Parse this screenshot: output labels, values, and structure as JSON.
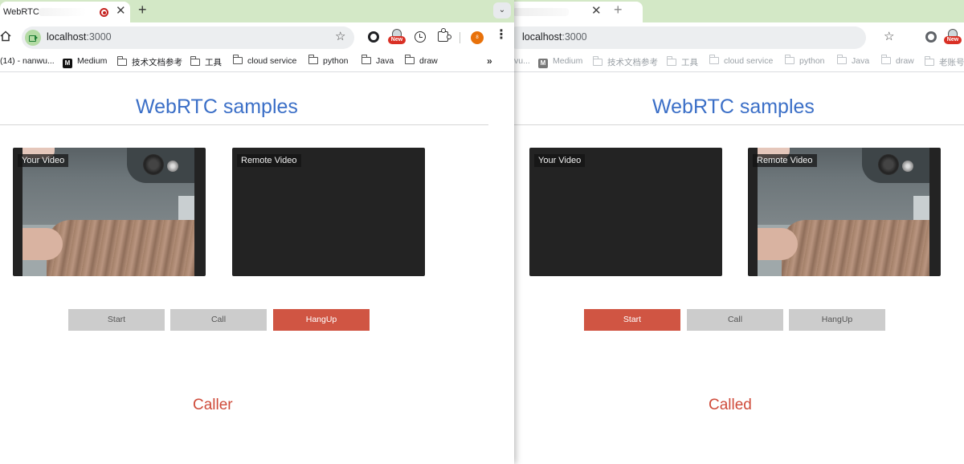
{
  "colors": {
    "heading": "#3b6fc7",
    "active_button": "#d05543",
    "role_text": "#cf4b3a",
    "tab_strip": "#d3e8c6"
  },
  "caller": {
    "tab": {
      "title": "WebRTC ⁻",
      "recording_icon": "record-icon"
    },
    "url": {
      "host": "localhost",
      "port": ":3000"
    },
    "new_badge": "New",
    "avatar_text": "8",
    "bookmarks": [
      {
        "label": "(14) - nanwu...",
        "icon": "none"
      },
      {
        "label": "Medium",
        "icon": "medium-icon"
      },
      {
        "label": "技术文档参考",
        "icon": "folder-icon"
      },
      {
        "label": "工具",
        "icon": "folder-icon"
      },
      {
        "label": "cloud service",
        "icon": "folder-icon"
      },
      {
        "label": "python",
        "icon": "folder-icon"
      },
      {
        "label": "Java",
        "icon": "folder-icon"
      },
      {
        "label": "draw",
        "icon": "folder-icon"
      }
    ],
    "bookmarks_more": "»",
    "page": {
      "title": "WebRTC samples",
      "local_video_label": "Your Video",
      "remote_video_label": "Remote Video",
      "local_video_has_stream": true,
      "remote_video_has_stream": false,
      "buttons": [
        {
          "label": "Start",
          "active": false
        },
        {
          "label": "Call",
          "active": false
        },
        {
          "label": "HangUp",
          "active": true
        }
      ],
      "role": "Caller"
    }
  },
  "called": {
    "url": {
      "host": "localhost",
      "port": ":3000"
    },
    "new_badge": "New",
    "bookmarks": [
      {
        "label": "vu...",
        "icon": "none"
      },
      {
        "label": "Medium",
        "icon": "medium-icon"
      },
      {
        "label": "技术文档参考",
        "icon": "folder-icon"
      },
      {
        "label": "工具",
        "icon": "folder-icon"
      },
      {
        "label": "cloud service",
        "icon": "folder-icon"
      },
      {
        "label": "python",
        "icon": "folder-icon"
      },
      {
        "label": "Java",
        "icon": "folder-icon"
      },
      {
        "label": "draw",
        "icon": "folder-icon"
      },
      {
        "label": "老账号",
        "icon": "folder-icon"
      }
    ],
    "page": {
      "title": "WebRTC samples",
      "local_video_label": "Your Video",
      "remote_video_label": "Remote Video",
      "local_video_has_stream": false,
      "remote_video_has_stream": true,
      "buttons": [
        {
          "label": "Start",
          "active": true
        },
        {
          "label": "Call",
          "active": false
        },
        {
          "label": "HangUp",
          "active": false
        }
      ],
      "role": "Called"
    }
  }
}
